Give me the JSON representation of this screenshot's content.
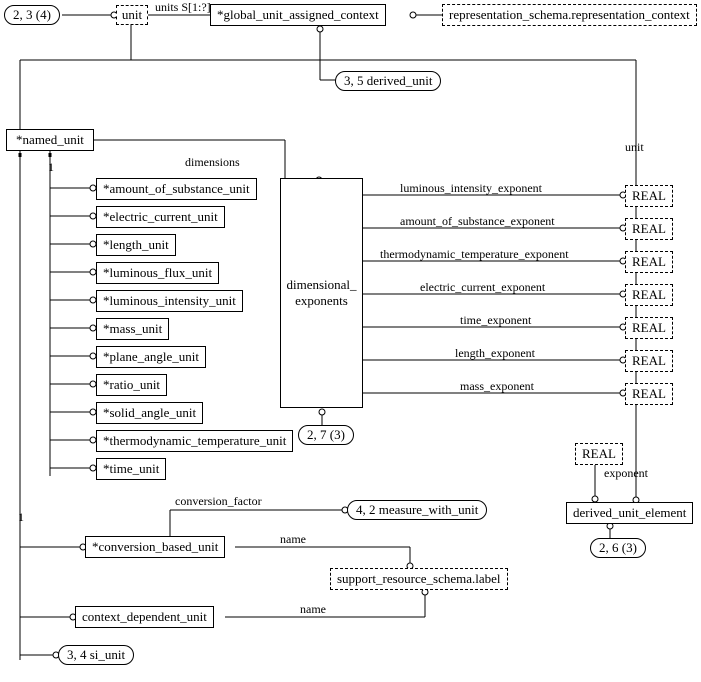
{
  "top": {
    "page_ref_left": "2, 3 (4)",
    "unit_label": "unit",
    "units_s": "units S[1:?]",
    "global_unit": "*global_unit_assigned_context",
    "rep_schema": "representation_schema.representation_context",
    "derived_unit": "3, 5 derived_unit"
  },
  "named_unit": "*named_unit",
  "unit_label_right": "unit",
  "dimensions_label": "dimensions",
  "inherit_one_a": "1",
  "inherit_one_b": "1",
  "subtypes": [
    "*amount_of_substance_unit",
    "*electric_current_unit",
    "*length_unit",
    "*luminous_flux_unit",
    "*luminous_intensity_unit",
    "*mass_unit",
    "*plane_angle_unit",
    "*ratio_unit",
    "*solid_angle_unit",
    "*thermodynamic_temperature_unit",
    "*time_unit"
  ],
  "dim_exp_box": "dimensional_\nexponents",
  "dim_exp_page": "2, 7 (3)",
  "exponents": [
    "luminous_intensity_exponent",
    "amount_of_substance_exponent",
    "thermodynamic_temperature_exponent",
    "electric_current_exponent",
    "time_exponent",
    "length_exponent",
    "mass_exponent"
  ],
  "real": "REAL",
  "exponent_label": "exponent",
  "derived_unit_element": "derived_unit_element",
  "d_u_e_page": "2, 6 (3)",
  "conversion_factor": "conversion_factor",
  "measure_with_unit": "4, 2 measure_with_unit",
  "conversion_based_unit": "*conversion_based_unit",
  "name_label_a": "name",
  "name_label_b": "name",
  "support_label": "support_resource_schema.label",
  "context_dependent_unit": "context_dependent_unit",
  "si_unit": "3, 4 si_unit"
}
